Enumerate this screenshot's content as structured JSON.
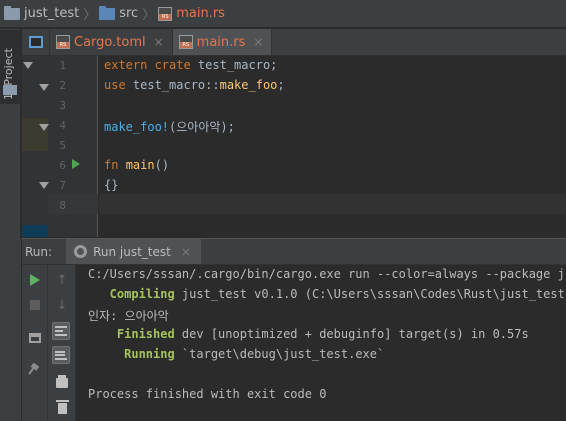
{
  "breadcrumb": {
    "project": "just_test",
    "folder": "src",
    "file": "main.rs"
  },
  "tool_window": {
    "project_tab_label": "1: Project"
  },
  "editor": {
    "tabs": [
      {
        "label": "Cargo.toml",
        "close": "×"
      },
      {
        "label": "main.rs",
        "close": "×"
      }
    ],
    "line_numbers": [
      "1",
      "2",
      "3",
      "4",
      "5",
      "6",
      "7",
      "8"
    ],
    "code": [
      [
        {
          "t": "extern crate",
          "c": "kw"
        },
        {
          "t": " test_macro;",
          "c": "id"
        }
      ],
      [
        {
          "t": "use",
          "c": "kw"
        },
        {
          "t": " test_macro::",
          "c": "id"
        },
        {
          "t": "make_foo",
          "c": "fn"
        },
        {
          "t": ";",
          "c": "id"
        }
      ],
      [],
      [
        {
          "t": "make_foo!",
          "c": "mac"
        },
        {
          "t": "(으아아악);",
          "c": "id"
        }
      ],
      [],
      [
        {
          "t": "fn",
          "c": "kw"
        },
        {
          "t": " ",
          "c": "id"
        },
        {
          "t": "main",
          "c": "fn"
        },
        {
          "t": "()",
          "c": "id"
        }
      ],
      [
        {
          "t": "{}",
          "c": "id"
        }
      ],
      []
    ]
  },
  "run_panel": {
    "title": "Run:",
    "tab_label": "Run just_test",
    "tab_close": "×",
    "toolbar_up": "↑",
    "toolbar_down": "↓",
    "console": [
      {
        "prefix": "",
        "text": "C:/Users/sssan/.cargo/bin/cargo.exe run --color=always --package just_test"
      },
      {
        "prefix": "   Compiling",
        "text": " just_test v0.1.0 (C:\\Users\\sssan\\Codes\\Rust\\just_test)"
      },
      {
        "prefix": "",
        "text": "인자: 으아아악"
      },
      {
        "prefix": "    Finished",
        "text": " dev [unoptimized + debuginfo] target(s) in 0.57s"
      },
      {
        "prefix": "     Running",
        "text": " `target\\debug\\just_test.exe`"
      },
      {
        "prefix": "",
        "text": ""
      },
      {
        "prefix": "",
        "text": "Process finished with exit code 0"
      }
    ]
  },
  "colors": {
    "keyword": "#cc7832",
    "function": "#ffc66d",
    "macro": "#4eade5",
    "console_status": "#a5c25c",
    "run_green": "#5fb35f"
  }
}
